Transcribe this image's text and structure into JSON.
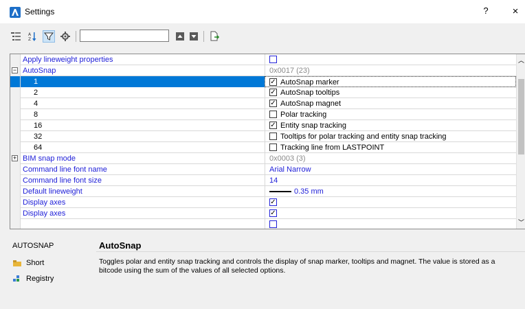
{
  "window": {
    "title": "Settings",
    "help_label": "?",
    "close_label": "×"
  },
  "toolbar": {
    "search_value": ""
  },
  "rows": [
    {
      "name": "Apply lineweight properties",
      "kind": "checkbox",
      "checked": false
    },
    {
      "name": "AutoSnap",
      "kind": "group",
      "value": "0x0017 (23)",
      "expander": "−"
    },
    {
      "name": "1",
      "label": "AutoSnap marker",
      "checked": true
    },
    {
      "name": "2",
      "label": "AutoSnap tooltips",
      "checked": true
    },
    {
      "name": "4",
      "label": "AutoSnap magnet",
      "checked": true
    },
    {
      "name": "8",
      "label": "Polar tracking",
      "checked": false
    },
    {
      "name": "16",
      "label": "Entity snap tracking",
      "checked": true
    },
    {
      "name": "32",
      "label": "Tooltips for polar tracking and entity snap tracking",
      "checked": false
    },
    {
      "name": "64",
      "label": "Tracking line from LASTPOINT",
      "checked": false
    },
    {
      "name": "BIM snap mode",
      "value": "0x0003 (3)",
      "expander": "+"
    },
    {
      "name": "Command line font name",
      "value": "Arial Narrow"
    },
    {
      "name": "Command line font size",
      "value": "14"
    },
    {
      "name": "Default lineweight",
      "value": "0.35 mm"
    },
    {
      "name": "Display axes",
      "checked": true
    },
    {
      "name": "Display axes",
      "checked": true
    }
  ],
  "description": {
    "key": "AUTOSNAP",
    "title": "AutoSnap",
    "text": "Toggles polar and entity snap tracking and controls the display of snap marker, tooltips and magnet. The value is stored as a bitcode using the sum of the values of all selected options.",
    "short_label": "Short",
    "registry_label": "Registry"
  }
}
